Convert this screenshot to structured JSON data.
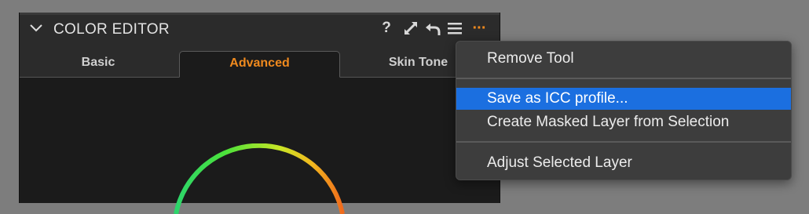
{
  "panel": {
    "title": "COLOR EDITOR",
    "header_icons": [
      "question-icon",
      "expand-icon",
      "reset-icon",
      "list-icon",
      "more-icon"
    ],
    "help_glyph": "?",
    "more_glyph": "···",
    "accent_color": "#f08a1e"
  },
  "tabs": [
    {
      "label": "Basic",
      "active": false
    },
    {
      "label": "Advanced",
      "active": true
    },
    {
      "label": "Skin Tone",
      "active": false
    }
  ],
  "menu": {
    "items": [
      {
        "label": "Remove Tool",
        "highlighted": false
      },
      {
        "label": "Save as ICC profile...",
        "highlighted": true
      },
      {
        "label": "Create Masked Layer from Selection",
        "highlighted": false
      },
      {
        "label": "Adjust Selected Layer",
        "highlighted": false
      }
    ],
    "highlight_color": "#1b6fe0"
  }
}
